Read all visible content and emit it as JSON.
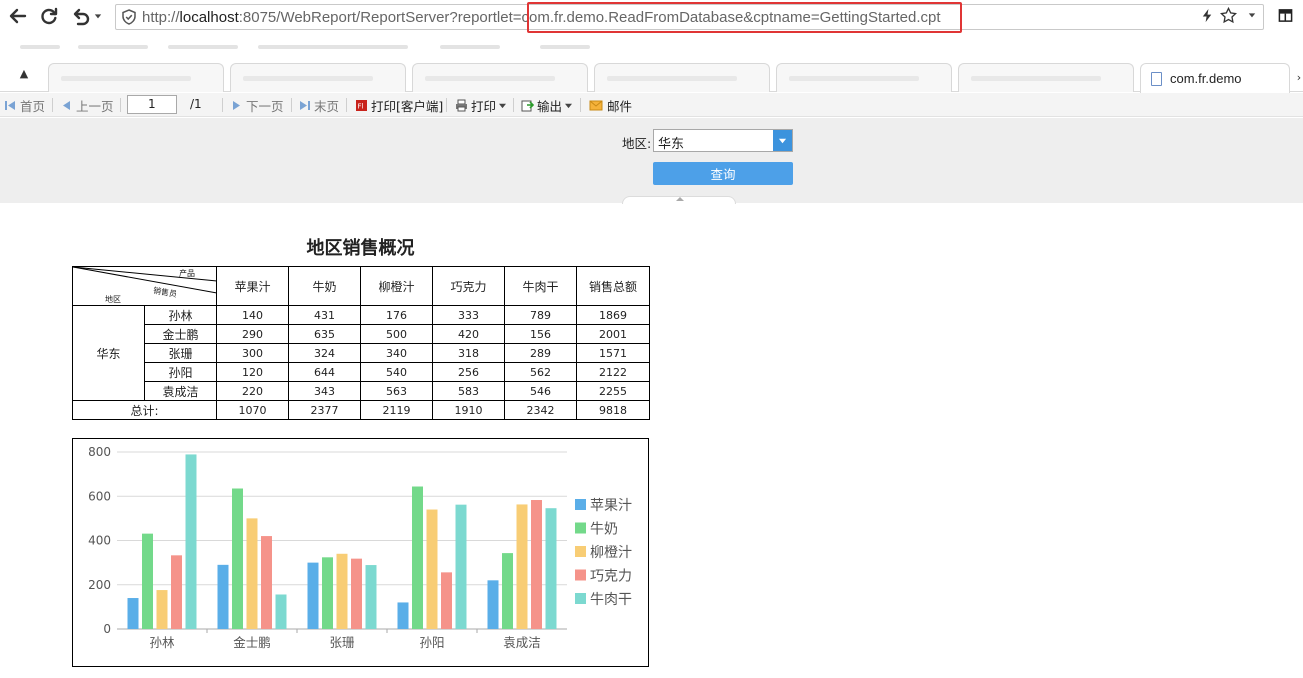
{
  "browser": {
    "url_prefix": "http://",
    "url_host": "localhost",
    "url_rest": ":8075/WebReport/ReportServer?reportlet=com.fr.demo.ReadFromDatabase&cptname=GettingStarted.cpt",
    "active_tab_label": "com.fr.demo",
    "icons": [
      "back-icon",
      "refresh-icon",
      "undo-icon",
      "shield-icon",
      "lightning-icon",
      "star-icon",
      "menu-icon"
    ]
  },
  "toolbar": {
    "first": "首页",
    "prev": "上一页",
    "page_value": "1",
    "page_total": "/1",
    "next": "下一页",
    "last": "末页",
    "print_client": "打印[客户端]",
    "print": "打印",
    "export": "输出",
    "email": "邮件"
  },
  "params": {
    "region_label": "地区:",
    "region_value": "华东",
    "query_label": "查询"
  },
  "report": {
    "title": "地区销售概况",
    "diag": {
      "product": "产品",
      "sales": "销售员",
      "region": "地区"
    },
    "columns": [
      "苹果汁",
      "牛奶",
      "柳橙汁",
      "巧克力",
      "牛肉干",
      "销售总额"
    ],
    "region": "华东",
    "rows": [
      {
        "name": "孙林",
        "values": [
          "140",
          "431",
          "176",
          "333",
          "789",
          "1869"
        ]
      },
      {
        "name": "金士鹏",
        "values": [
          "290",
          "635",
          "500",
          "420",
          "156",
          "2001"
        ]
      },
      {
        "name": "张珊",
        "values": [
          "300",
          "324",
          "340",
          "318",
          "289",
          "1571"
        ]
      },
      {
        "name": "孙阳",
        "values": [
          "120",
          "644",
          "540",
          "256",
          "562",
          "2122"
        ]
      },
      {
        "name": "袁成洁",
        "values": [
          "220",
          "343",
          "563",
          "583",
          "546",
          "2255"
        ]
      }
    ],
    "total_label": "总计:",
    "totals": [
      "1070",
      "2377",
      "2119",
      "1910",
      "2342",
      "9818"
    ]
  },
  "chart_data": {
    "type": "bar",
    "categories": [
      "孙林",
      "金士鹏",
      "张珊",
      "孙阳",
      "袁成洁"
    ],
    "series": [
      {
        "name": "苹果汁",
        "color": "#5aaee8",
        "values": [
          140,
          290,
          300,
          120,
          220
        ]
      },
      {
        "name": "牛奶",
        "color": "#73d98a",
        "values": [
          431,
          635,
          324,
          644,
          343
        ]
      },
      {
        "name": "柳橙汁",
        "color": "#f8cd75",
        "values": [
          176,
          500,
          340,
          540,
          563
        ]
      },
      {
        "name": "巧克力",
        "color": "#f5938a",
        "values": [
          333,
          420,
          318,
          256,
          583
        ]
      },
      {
        "name": "牛肉干",
        "color": "#7cd9d0",
        "values": [
          789,
          156,
          289,
          562,
          546
        ]
      }
    ],
    "yticks": [
      "0",
      "200",
      "400",
      "600",
      "800"
    ],
    "ylim": [
      0,
      800
    ],
    "grid": true,
    "legend": "right"
  }
}
